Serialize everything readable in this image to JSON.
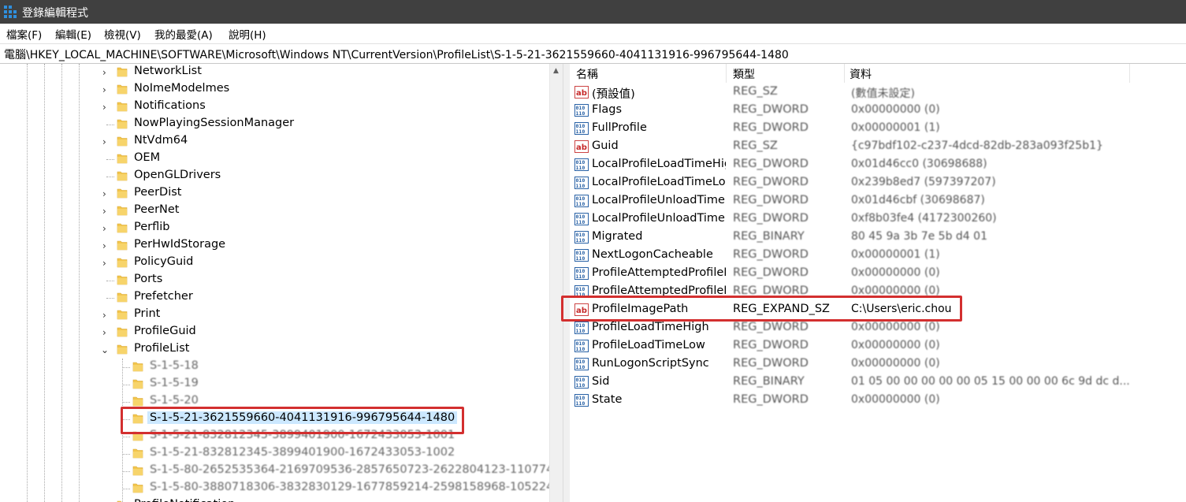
{
  "window": {
    "title": "登錄編輯程式",
    "app_icon": "registry-editor-icon"
  },
  "menu": [
    "檔案(F)",
    "編輯(E)",
    "檢視(V)",
    "我的最愛(A)",
    "說明(H)"
  ],
  "address": "電腦\\HKEY_LOCAL_MACHINE\\SOFTWARE\\Microsoft\\Windows NT\\CurrentVersion\\ProfileList\\S-1-5-21-3621559660-4041131916-996795644-1480",
  "tree": {
    "nodes": [
      {
        "label": "NetworkList",
        "expander": "collapsed"
      },
      {
        "label": "NoImeModelmes",
        "expander": "collapsed"
      },
      {
        "label": "Notifications",
        "expander": "collapsed"
      },
      {
        "label": "NowPlayingSessionManager",
        "expander": "none"
      },
      {
        "label": "NtVdm64",
        "expander": "collapsed"
      },
      {
        "label": "OEM",
        "expander": "none"
      },
      {
        "label": "OpenGLDrivers",
        "expander": "none"
      },
      {
        "label": "PeerDist",
        "expander": "collapsed"
      },
      {
        "label": "PeerNet",
        "expander": "collapsed"
      },
      {
        "label": "Perflib",
        "expander": "collapsed"
      },
      {
        "label": "PerHwIdStorage",
        "expander": "collapsed"
      },
      {
        "label": "PolicyGuid",
        "expander": "collapsed"
      },
      {
        "label": "Ports",
        "expander": "none"
      },
      {
        "label": "Prefetcher",
        "expander": "none"
      },
      {
        "label": "Print",
        "expander": "collapsed"
      },
      {
        "label": "ProfileGuid",
        "expander": "collapsed"
      },
      {
        "label": "ProfileList",
        "expander": "expanded"
      }
    ],
    "children": [
      {
        "label": "S-1-5-18"
      },
      {
        "label": "S-1-5-19"
      },
      {
        "label": "S-1-5-20"
      },
      {
        "label": "S-1-5-21-3621559660-4041131916-996795644-1480",
        "selected": true
      },
      {
        "label": "S-1-5-21-832812345-3899401900-1672433053-1001"
      },
      {
        "label": "S-1-5-21-832812345-3899401900-1672433053-1002"
      },
      {
        "label": "S-1-5-80-2652535364-2169709536-2857650723-2622804123-110774"
      },
      {
        "label": "S-1-5-80-3880718306-3832830129-1677859214-2598158968-105224"
      }
    ],
    "partial_next": "ProfileNotification"
  },
  "list": {
    "columns": [
      "名稱",
      "類型",
      "資料"
    ],
    "rows": [
      {
        "icon": "string-value-icon",
        "name": "(預設值)",
        "type": "REG_SZ",
        "data": "(數值未設定)"
      },
      {
        "icon": "binary-value-icon",
        "name": "Flags",
        "type": "REG_DWORD",
        "data": "0x00000000 (0)"
      },
      {
        "icon": "binary-value-icon",
        "name": "FullProfile",
        "type": "REG_DWORD",
        "data": "0x00000001 (1)"
      },
      {
        "icon": "string-value-icon",
        "name": "Guid",
        "type": "REG_SZ",
        "data": "{c97bdf102-c237-4dcd-82db-283a093f25b1}"
      },
      {
        "icon": "binary-value-icon",
        "name": "LocalProfileLoadTimeHigh",
        "type": "REG_DWORD",
        "data": "0x01d46cc0 (30698688)"
      },
      {
        "icon": "binary-value-icon",
        "name": "LocalProfileLoadTimeLow",
        "type": "REG_DWORD",
        "data": "0x239b8ed7 (597397207)"
      },
      {
        "icon": "binary-value-icon",
        "name": "LocalProfileUnloadTimeHigh",
        "type": "REG_DWORD",
        "data": "0x01d46cbf (30698687)"
      },
      {
        "icon": "binary-value-icon",
        "name": "LocalProfileUnloadTimeLow",
        "type": "REG_DWORD",
        "data": "0xf8b03fe4 (4172300260)"
      },
      {
        "icon": "binary-value-icon",
        "name": "Migrated",
        "type": "REG_BINARY",
        "data": "80 45 9a 3b 7e 5b d4 01"
      },
      {
        "icon": "binary-value-icon",
        "name": "NextLogonCacheable",
        "type": "REG_DWORD",
        "data": "0x00000001 (1)"
      },
      {
        "icon": "binary-value-icon",
        "name": "ProfileAttemptedProfileDownloadTimeHigh",
        "type": "REG_DWORD",
        "data": "0x00000000 (0)"
      },
      {
        "icon": "binary-value-icon",
        "name": "ProfileAttemptedProfileDownloadTimeLow",
        "type": "REG_DWORD",
        "data": "0x00000000 (0)"
      },
      {
        "icon": "string-value-icon",
        "name": "ProfileImagePath",
        "type": "REG_EXPAND_SZ",
        "data": "C:\\Users\\eric.chou",
        "highlight": true
      },
      {
        "icon": "binary-value-icon",
        "name": "ProfileLoadTimeHigh",
        "type": "REG_DWORD",
        "data": "0x00000000 (0)"
      },
      {
        "icon": "binary-value-icon",
        "name": "ProfileLoadTimeLow",
        "type": "REG_DWORD",
        "data": "0x00000000 (0)"
      },
      {
        "icon": "binary-value-icon",
        "name": "RunLogonScriptSync",
        "type": "REG_DWORD",
        "data": "0x00000000 (0)"
      },
      {
        "icon": "binary-value-icon",
        "name": "Sid",
        "type": "REG_BINARY",
        "data": "01 05 00 00 00 00 00 05 15 00 00 00 6c 9d dc d..."
      },
      {
        "icon": "binary-value-icon",
        "name": "State",
        "type": "REG_DWORD",
        "data": "0x00000000 (0)"
      }
    ]
  },
  "colors": {
    "titlebar": "#404040",
    "selection": "#cce8ff",
    "highlight_border": "#d32f2f",
    "folder": "#f3c64d"
  }
}
